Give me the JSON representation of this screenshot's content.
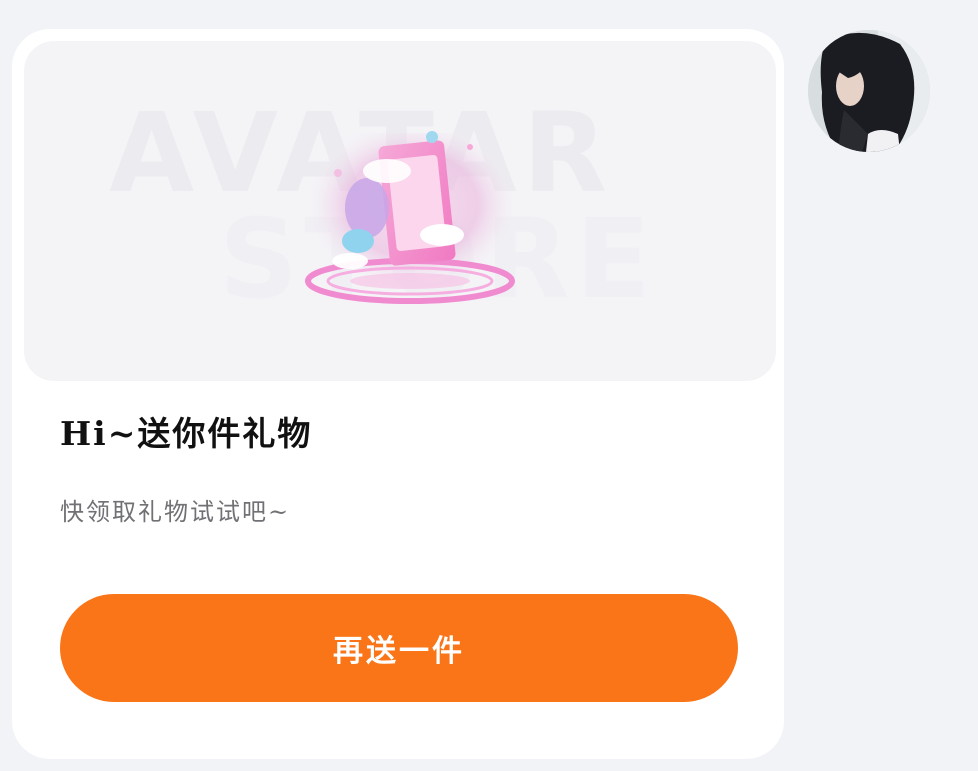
{
  "card": {
    "title": "Hi~送你件礼物",
    "subtitle": "快领取礼物试试吧~",
    "button_label": "再送一件"
  },
  "banner": {
    "watermark_line1": "AVATAR",
    "watermark_line2": "STORE",
    "image": "gift-avatar-item"
  },
  "sender": {
    "avatar": "user-avatar-photo"
  },
  "colors": {
    "background": "#f2f3f7",
    "card": "#ffffff",
    "banner": "#f4f4f7",
    "button": "#f97518",
    "title": "#111111",
    "subtitle": "#707075"
  }
}
